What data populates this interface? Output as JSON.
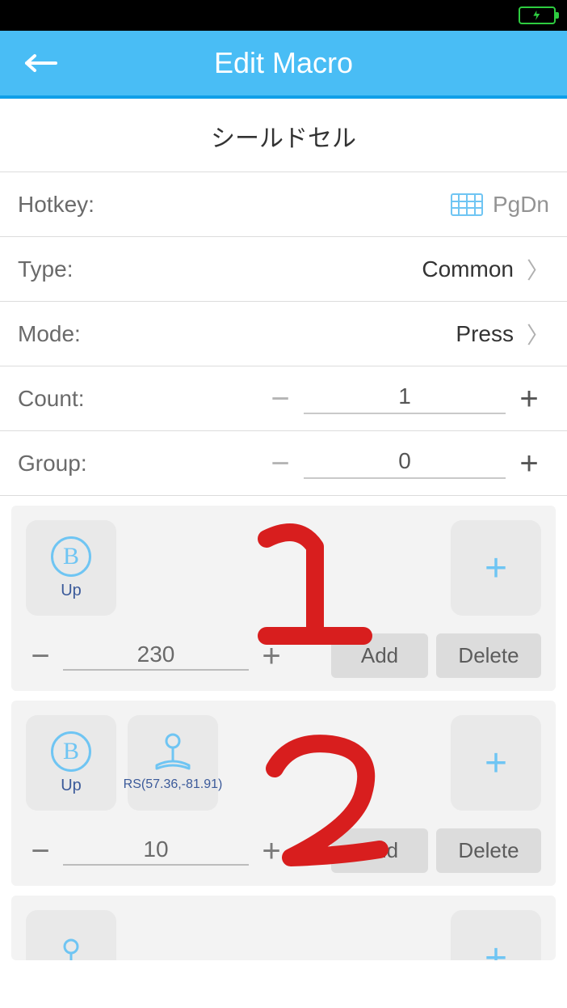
{
  "header": {
    "title": "Edit Macro"
  },
  "macro_name": "シールドセル",
  "fields": {
    "hotkey_label": "Hotkey:",
    "hotkey_value": "PgDn",
    "type_label": "Type:",
    "type_value": "Common",
    "mode_label": "Mode:",
    "mode_value": "Press",
    "count_label": "Count:",
    "count_value": "1",
    "group_label": "Group:",
    "group_value": "0"
  },
  "buttons": {
    "add": "Add",
    "delete": "Delete"
  },
  "steps": [
    {
      "actions": [
        {
          "icon": "circle-b",
          "label": "Up"
        }
      ],
      "delay": "230"
    },
    {
      "actions": [
        {
          "icon": "circle-b",
          "label": "Up"
        },
        {
          "icon": "joystick",
          "label": "RS(57.36,-81.91)"
        }
      ],
      "delay": "10"
    },
    {
      "actions": [
        {
          "icon": "joystick",
          "label": ""
        }
      ],
      "delay": ""
    }
  ],
  "annotations": [
    "1",
    "2"
  ]
}
